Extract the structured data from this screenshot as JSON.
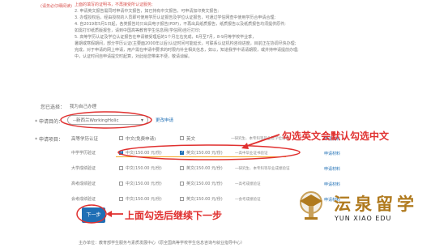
{
  "notice": {
    "side_label": "(请务必仔细阅读)",
    "lines": [
      "上面的填写的证明书，不再接受所认证服务;",
      "2. 申请英文报告需同时申请中文报告，如已持有中文报告，可申请加印英文报告;",
      "3. 办理授权后，经由授权的人员即可使用学历认证报告及学位认证报告，可通过学信网查中使用学历合申请合理;",
      "4. 自2019年5月1日起，各类报告均只出具电子报告(PDF)，不再出具纸质报告，纸质报告以及纸质报告均须提供原件;",
      "   如需打印纸质版报告，请到中国高等教育学生信息网(学信网)自行打印;",
      "5. 高等学历认证及学位认证报告在申请被受理后的1个月左右完成，6月至7月，8-9月等学校毕业季，",
      "   暑期或寒假期间，部分学历认证(主要面2000年以后)认证时间可能延长，可联系认证机构咨询进度，目前正在协调尽快办理;",
      "   完成，对于申请的网上申请，用户需在申请中要求的时限内补全相关信息，如以，知道我学中请请期限，或并持申请提前办理;",
      "   中，认证时间自申请提交时起算，对此给您带来不便，敬请谅解。"
    ]
  },
  "form": {
    "contact_label": "您已选择：",
    "contact_value": "我为自己办理",
    "purpose_label": "* 申请目的：",
    "purpose_value": "--新西兰WorkingHolic",
    "purpose_link": "更改申请",
    "items_label": "* 申请项目：",
    "col_report": "高等学历认证",
    "col_cn": "中文(免费申请)",
    "col_en": "英文",
    "col_note": "一研究生、本专科等毕业及学位信息",
    "col_apply": "申请材料"
  },
  "rows": [
    {
      "name": "中学学历验证",
      "cn": "中文(150.00 元/份)",
      "cn_checked": true,
      "en": "英文(150.00 元/份)",
      "en_checked": true,
      "note": "一高中毕业证书验证",
      "apply": "申请材料"
    },
    {
      "name": "大学成绩验证",
      "cn": "中文(150.00 元/份)",
      "cn_checked": false,
      "en": "英文(150.00 元/份)",
      "en_checked": false,
      "note": "一研究生、本专科等毕业成绩验证",
      "apply": "申请材料"
    },
    {
      "name": "高考成绩验证",
      "cn": "中文(150.00 元/份)",
      "cn_checked": false,
      "en": "英文(150.00 元/份)",
      "en_checked": false,
      "note": "一高考成绩验证",
      "apply": "申请材料"
    },
    {
      "name": "会考成绩验证",
      "cn": "中文(150.00 元/份)",
      "cn_checked": false,
      "en": "英文(150.00 元/份)",
      "en_checked": false,
      "note": "一会考成绩验证",
      "apply": "申请材料"
    }
  ],
  "next_button": "下一步",
  "footer": "主办单位：教育部学生服务与素质发展中心（原全国高等学校学生信息咨询与就业指导中心）",
  "annotations": {
    "english_default": "勾选英文会默认勾选中文",
    "next_hint": "上面勾选后继续下一步",
    "colors": {
      "red": "#e0302f",
      "orange": "#f5a623",
      "blue": "#1f6fb5",
      "brand_gold": "#b07a1e"
    }
  },
  "brand": {
    "cn": "沄泉留学",
    "en": "YUN XIAO EDU"
  }
}
